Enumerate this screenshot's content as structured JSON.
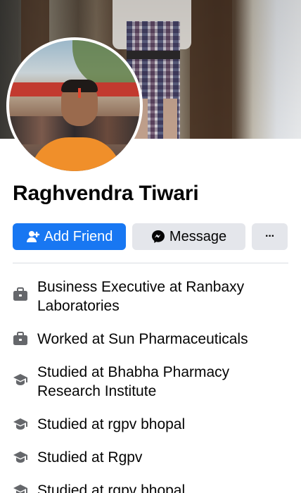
{
  "profile": {
    "name": "Raghvendra Tiwari"
  },
  "actions": {
    "add_friend_label": "Add Friend",
    "message_label": "Message",
    "more_label": "···"
  },
  "colors": {
    "primary": "#1877f2",
    "secondary_button": "#e4e6eb",
    "icon_gray": "#65676b"
  },
  "info": [
    {
      "icon": "briefcase-icon",
      "text": "Business Executive at Ranbaxy Laboratories"
    },
    {
      "icon": "briefcase-icon",
      "text": "Worked at Sun Pharmaceuticals"
    },
    {
      "icon": "graduation-cap-icon",
      "text": "Studied at Bhabha Pharmacy Research Institute"
    },
    {
      "icon": "graduation-cap-icon",
      "text": "Studied at rgpv bhopal"
    },
    {
      "icon": "graduation-cap-icon",
      "text": "Studied at Rgpv"
    },
    {
      "icon": "graduation-cap-icon",
      "text": "Studied at rgpv bhopal"
    }
  ]
}
